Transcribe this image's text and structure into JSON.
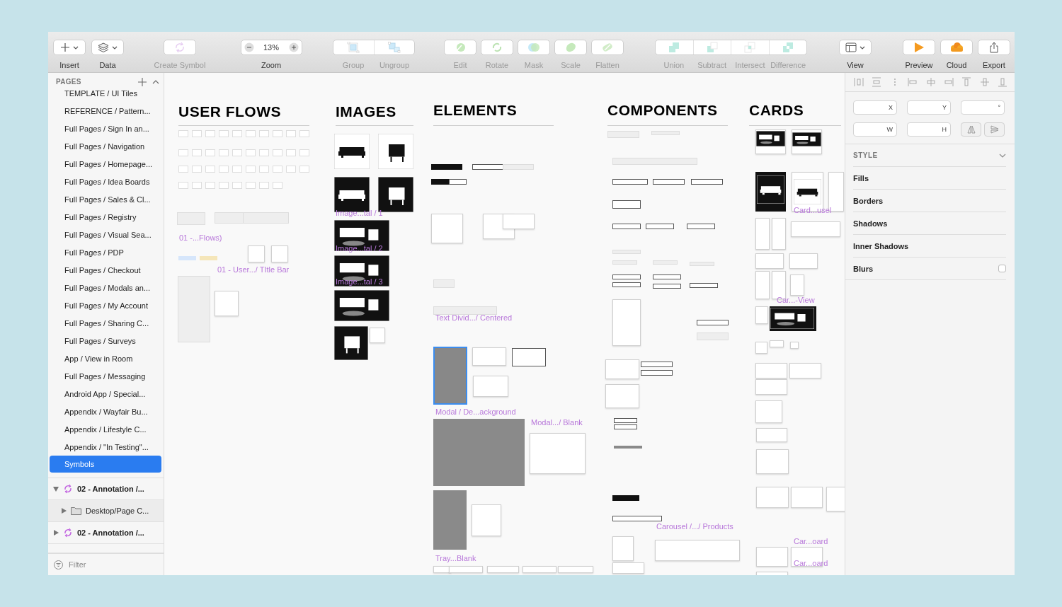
{
  "toolbar": [
    {
      "kind": "dropdown",
      "label": "Insert",
      "disabled": false
    },
    {
      "kind": "dropdown",
      "label": "Data",
      "disabled": false
    },
    {
      "kind": "button",
      "label": "Create Symbol",
      "disabled": true
    },
    {
      "kind": "zoom",
      "label": "Zoom",
      "value": "13%"
    },
    {
      "kind": "segmented",
      "items": [
        {
          "label": "Group",
          "disabled": true
        },
        {
          "label": "Ungroup",
          "disabled": true
        }
      ]
    },
    {
      "kind": "button",
      "label": "Edit",
      "disabled": true
    },
    {
      "kind": "button",
      "label": "Rotate",
      "disabled": true
    },
    {
      "kind": "button",
      "label": "Mask",
      "disabled": true
    },
    {
      "kind": "button",
      "label": "Scale",
      "disabled": true
    },
    {
      "kind": "button",
      "label": "Flatten",
      "disabled": true
    },
    {
      "kind": "segmented",
      "items": [
        {
          "label": "Union",
          "disabled": true
        },
        {
          "label": "Subtract",
          "disabled": true
        },
        {
          "label": "Intersect",
          "disabled": true
        },
        {
          "label": "Difference",
          "disabled": true
        }
      ]
    },
    {
      "kind": "dropdown",
      "label": "View",
      "disabled": false
    },
    {
      "kind": "button",
      "label": "Preview",
      "disabled": false
    },
    {
      "kind": "button",
      "label": "Cloud",
      "disabled": false
    },
    {
      "kind": "button",
      "label": "Export",
      "disabled": false
    }
  ],
  "sidebar": {
    "title": "PAGES",
    "pages": [
      {
        "label": "TEMPLATE / UI Tiles",
        "selected": false
      },
      {
        "label": "REFERENCE / Pattern...",
        "selected": false
      },
      {
        "label": "Full Pages / Sign In an...",
        "selected": false
      },
      {
        "label": "Full Pages / Navigation",
        "selected": false
      },
      {
        "label": "Full Pages / Homepage...",
        "selected": false
      },
      {
        "label": "Full Pages / Idea Boards",
        "selected": false
      },
      {
        "label": "Full Pages / Sales & Cl...",
        "selected": false
      },
      {
        "label": "Full Pages / Registry",
        "selected": false
      },
      {
        "label": "Full Pages / Visual Sea...",
        "selected": false
      },
      {
        "label": "Full Pages / PDP",
        "selected": false
      },
      {
        "label": "Full Pages / Checkout",
        "selected": false
      },
      {
        "label": "Full Pages / Modals an...",
        "selected": false
      },
      {
        "label": "Full Pages / My Account",
        "selected": false
      },
      {
        "label": "Full Pages / Sharing C...",
        "selected": false
      },
      {
        "label": "Full Pages / Surveys",
        "selected": false
      },
      {
        "label": "App / View in Room",
        "selected": false
      },
      {
        "label": "Full Pages / Messaging",
        "selected": false
      },
      {
        "label": "Android App / Special...",
        "selected": false
      },
      {
        "label": "Appendix / Wayfair Bu...",
        "selected": false
      },
      {
        "label": "Appendix / Lifestyle C...",
        "selected": false
      },
      {
        "label": "Appendix / \"In Testing\"...",
        "selected": false
      },
      {
        "label": "Symbols",
        "selected": true
      }
    ],
    "layers": [
      {
        "kind": "symbol",
        "label": "02 - Annotation /...",
        "expanded": true,
        "children": [
          {
            "kind": "folder",
            "label": "Desktop/Page C...",
            "expanded": false
          }
        ]
      },
      {
        "kind": "symbol",
        "label": "02 - Annotation /...",
        "expanded": false
      }
    ],
    "filter": {
      "placeholder": "Filter"
    }
  },
  "canvas": {
    "headings": [
      "USER FLOWS",
      "IMAGES",
      "ELEMENTS",
      "COMPONENTS",
      "CARDS"
    ],
    "artboard_labels": [
      "01 -...Flows)",
      "01 - User.../  TItle Bar",
      "Image...tal / 1",
      "Image...tal / 2",
      "Image...tal / 3",
      "Text Divid.../ Centered",
      "Modal / De...ackground",
      "Modal.../ Blank",
      "Tray...Blank",
      "Carousel /.../ Products",
      "Card...usel",
      "Car...-View",
      "Car...oard",
      "Car...oard"
    ]
  },
  "inspector": {
    "fields": [
      {
        "label": "X"
      },
      {
        "label": "Y"
      },
      {
        "label": "°"
      },
      {
        "label": "W"
      },
      {
        "label": "H"
      }
    ],
    "style_title": "STYLE",
    "sections": [
      {
        "kind": "plain",
        "label": "Fills"
      },
      {
        "kind": "plain",
        "label": "Borders"
      },
      {
        "kind": "plain",
        "label": "Shadows"
      },
      {
        "kind": "plain",
        "label": "Inner Shadows"
      },
      {
        "kind": "checkbox",
        "label": "Blurs",
        "checked": false
      }
    ]
  }
}
